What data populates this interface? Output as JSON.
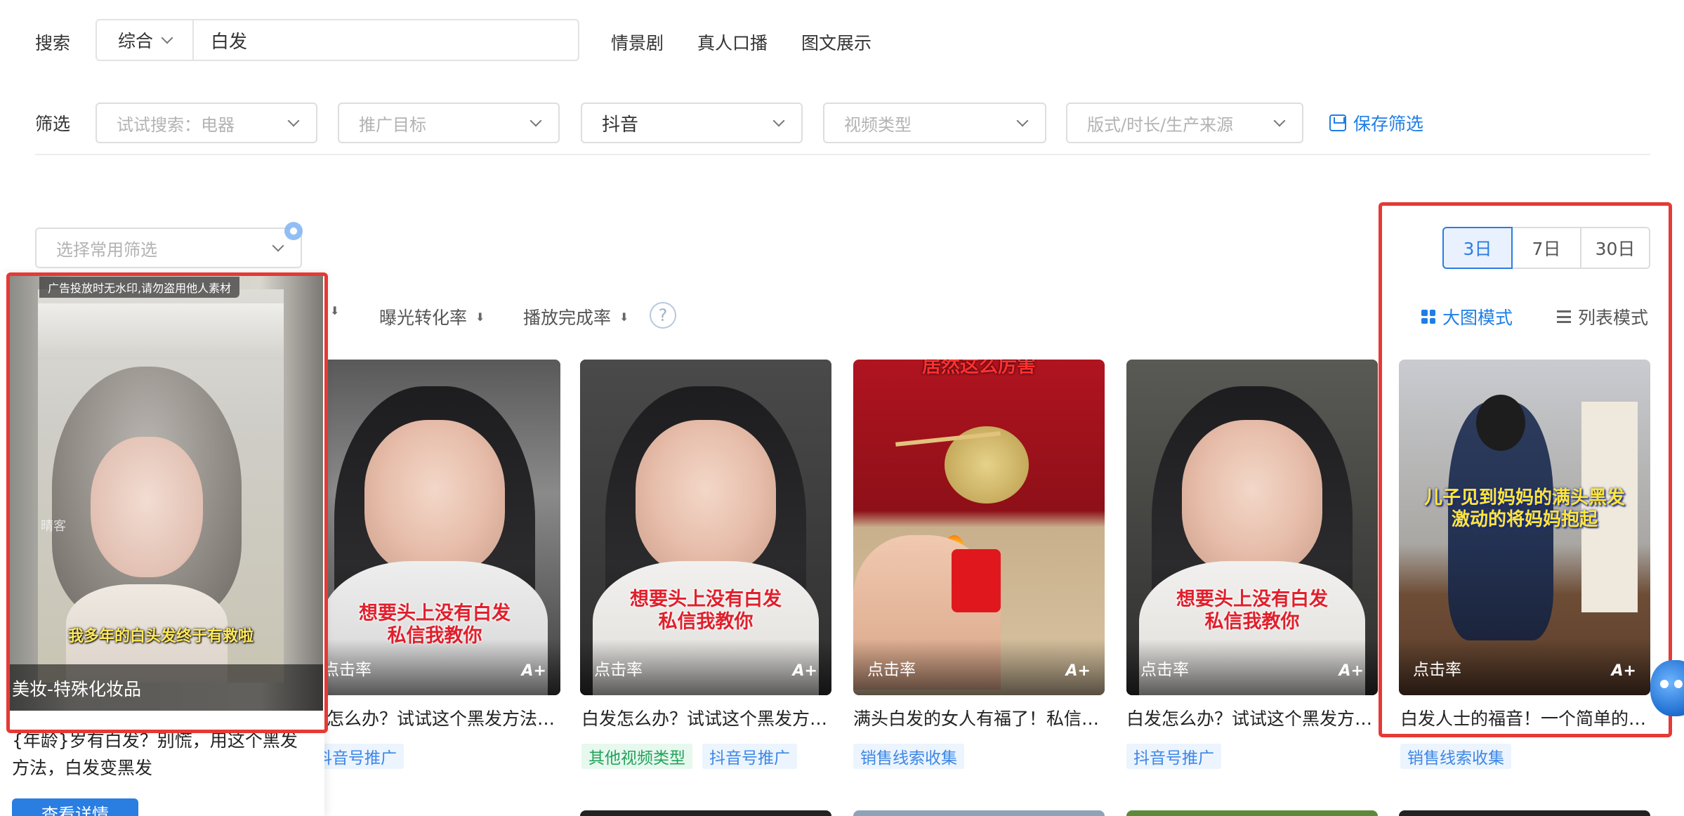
{
  "search": {
    "label": "搜索",
    "type_value": "综合",
    "query": "白发",
    "tabs": [
      "情景剧",
      "真人口播",
      "图文展示"
    ]
  },
  "filter": {
    "label": "筛选",
    "selects": [
      {
        "text": "试试搜索：电器",
        "filled": false
      },
      {
        "text": "推广目标",
        "filled": false
      },
      {
        "text": "抖音",
        "filled": true
      },
      {
        "text": "视频类型",
        "filled": false
      },
      {
        "text": "版式/时长/生产来源",
        "filled": false
      }
    ],
    "save_label": "保存筛选"
  },
  "common_filter_placeholder": "选择常用筛选",
  "day_options": [
    {
      "label": "3日",
      "active": true
    },
    {
      "label": "7日",
      "active": false
    },
    {
      "label": "30日",
      "active": false
    }
  ],
  "view_modes": {
    "large": "大图模式",
    "list": "列表模式"
  },
  "sort": {
    "exposure": "曝光转化率",
    "completion": "播放完成率",
    "help": "?"
  },
  "cards": [
    {
      "caption": "想要头上没有白发\n私信我教你",
      "metric": "点击率",
      "grade": "A+",
      "title": "发怎么办？试试这个黑发方法，白发变黑发",
      "tags": [
        {
          "text": "抖音号推广",
          "color": "blue"
        }
      ]
    },
    {
      "caption": "想要头上没有白发\n私信我教你",
      "metric": "点击率",
      "grade": "A+",
      "title": "白发怎么办？试试这个黑发方法，白发变黑发",
      "tags": [
        {
          "text": "其他视频类型",
          "color": "green"
        },
        {
          "text": "抖音号推广",
          "color": "blue"
        }
      ]
    },
    {
      "caption": "居然这么厉害",
      "metric": "点击率",
      "grade": "A+",
      "title": "满头白发的女人有福了！私信我教你",
      "tags": [
        {
          "text": "销售线索收集",
          "color": "blue"
        }
      ]
    },
    {
      "caption": "想要头上没有白发\n私信我教你",
      "metric": "点击率",
      "grade": "A+",
      "title": "白发怎么办？试试这个黑发方法，白发变黑发",
      "tags": [
        {
          "text": "抖音号推广",
          "color": "blue"
        }
      ]
    },
    {
      "caption": "儿子见到妈妈的满头黑发\n激动的将妈妈抱起",
      "metric": "点击率",
      "grade": "A+",
      "title": "白发人士的福音！一个简单的方法",
      "tags": [
        {
          "text": "销售线索收集",
          "color": "blue"
        }
      ]
    }
  ],
  "preview": {
    "notice": "广告投放时无水印,请勿盗用他人素材",
    "caption": "我多年的白头发终于有救啦",
    "watermark": "晴客",
    "category": "美妆-特殊化妆品",
    "description": "{年龄}岁有白发？别慌，用这个黑发方法，白发变黑发",
    "detail_button": "查看详情"
  },
  "colors": {
    "accent": "#2a7de1",
    "highlight": "#e53935",
    "tag_blue": "#3d87e6",
    "tag_green": "#23a35a"
  }
}
